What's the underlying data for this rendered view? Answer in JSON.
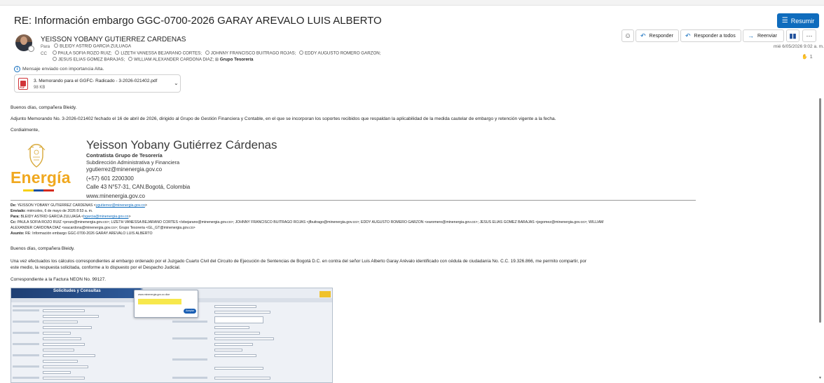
{
  "email": {
    "subject": "RE: Información embargo GGC-0700-2026 GARAY AREVALO LUIS ALBERTO",
    "summarize_label": "Resumir",
    "sender": "YEISSON YOBANY GUTIERREZ CARDENAS",
    "to_label": "Para",
    "to": "BLEIDY ASTRID GARCIA ZULUAGA",
    "cc_label": "CC",
    "cc": [
      "PAULA SOFIA ROZO RUIZ;",
      "LIZETH VANESSA BEJARANO CORTES;",
      "JOHNNY FRANCISCO BUITRAGO ROJAS;",
      "EDDY AUGUSTO ROMERO GARZON;"
    ],
    "cc2": [
      "JESUS ELIAS GOMEZ BARAJAS;",
      "WILLIAM ALEXANDER CARDONA DIAZ;"
    ],
    "cc_group": "Grupo Tesorería",
    "importance": "Mensaje enviado con importancia Alta.",
    "datetime": "mié 6/05/2026 9:02 a. m.",
    "like_count": "1",
    "attachment": {
      "name": "3. Memorando para el GGFC- Radicado - 3-2026-021402.pdf",
      "size": "98 KB",
      "type_label": "PDF"
    }
  },
  "toolbar": {
    "reply": "Responder",
    "reply_all": "Responder a todos",
    "forward": "Reenviar"
  },
  "body": {
    "greeting": "Buenos días, compañera Bleidy.",
    "paragraph": "Adjunto Memorando No. 3-2026-021402 fechado el 16 de abril de 2026, dirigido al Grupo de Gestión Financiera y Contable, en el que se incorporan los soportes recibidos que respaldan la aplicabilidad de la medida cautelar de embargo y retención vigente a la fecha.",
    "closing": "Cordialmente,"
  },
  "signature": {
    "logo_text": "Energía",
    "name": "Yeisson Yobany Gutiérrez Cárdenas",
    "role": "Contratista Grupo de Tesorería",
    "dept": "Subdirección Administrativa y Financiera",
    "email": "ygutierrez@minenergia.gov.co",
    "phone": "(+57) 601 2200300",
    "address": "Calle 43 N°57-31, CAN.Bogotá, Colombia",
    "web": "www.minenergia.gov.co"
  },
  "forwarded": {
    "from_label": "De:",
    "from": "YEISSON YOBANY GUTIERREZ CARDENAS <",
    "from_email": "ygutierrez@minenergia.gov.co",
    "from_end": ">",
    "sent_label": "Enviado:",
    "sent": "miércoles, 6 de mayo de 2026 8:53 a. m.",
    "to_label": "Para:",
    "to": "BLEIDY ASTRID GARCIA ZULUAGA <",
    "to_email": "bgarcia@minenergia.gov.co",
    "to_end": ">",
    "cc_label": "Cc:",
    "cc_line1": "PAULA SOFIA ROZO RUIZ <prozo@minenergia.gov.co>; LIZETH VANESSA BEJARANO CORTES <lvbejarano@minenergia.gov.co>; JOHNNY FRANCISCO BUITRAGO ROJAS <jfbuitrago@minenergia.gov.co>; EDDY AUGUSTO ROMERO GARZON <earomero@minenergia.gov.co>; JESUS ELIAS GOMEZ BARAJAS <jegomez@minenergia.gov.co>; WILLIAM",
    "cc_line2": "ALEXANDER CARDONA DIAZ <wacardona@minenergia.gov.co>; Grupo Tesoreria <GL_GT@minenergia.gov.co>",
    "subject_label": "Asunto:",
    "subject": "RE: Información embargo GGC-0700-2026 GARAY AREVALO LUIS ALBERTO",
    "greeting": "Buenos días, compañera Bleidy.",
    "para_line1": "Una vez efectuados los cálculos correspondientes al embargo ordenado por el Juzgado Cuarto Civil del Circuito de Ejecución de Sentencias de Bogotá D.C. en contra del señor Luis Alberto Garay Arévalo identificado con cédula de ciudadanía No. C.C. 19.326.866, me permito compartir, por",
    "para_line2": "este medio, la respuesta solicitada, conforme a lo dispuesto por el Despacho Judicial.",
    "invoice": "Correspondiente a la Factura NEON No. 99127."
  },
  "embedded_screenshot": {
    "title": "Solicitudes y Consultas",
    "dialog_text": "www.minenergia.gov.co dice",
    "dialog_button": "Aceptar"
  },
  "colors": {
    "accent": "#0f6cbd",
    "energia_orange": "#f0a81f",
    "highlight": "#f7e84c"
  }
}
